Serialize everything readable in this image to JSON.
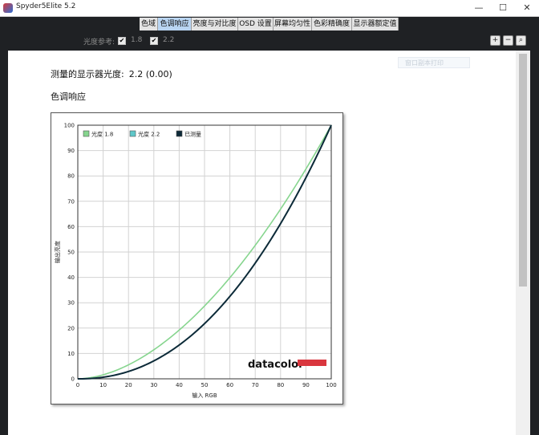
{
  "window": {
    "title": "Spyder5Elite 5.2",
    "minimize": "—",
    "maximize": "☐",
    "close": "✕"
  },
  "tabs": [
    {
      "label": "色域"
    },
    {
      "label": "色调响应",
      "active": true
    },
    {
      "label": "亮度与对比度"
    },
    {
      "label": "OSD 设置"
    },
    {
      "label": "屏幕均匀性"
    },
    {
      "label": "色彩精确度"
    },
    {
      "label": "显示器额定值"
    }
  ],
  "gamma_ref": {
    "label": "光度参考:",
    "opt1": "1.8",
    "opt2": "2.2",
    "check": "✔"
  },
  "zoom": {
    "zoom_in": "+",
    "zoom_out": "−",
    "zoom_fit": "⌕"
  },
  "main": {
    "measure_label": "测量的显示器光度:",
    "measure_value": "2.2 (0.00)",
    "section_title": "色调响应",
    "ghost_button": "窗口副本打印"
  },
  "brand": "datacolor",
  "colors": {
    "gamma18": "#86d58e",
    "gamma22": "#5fc7c9",
    "measured": "#0d2a38",
    "brand_bar": "#d9363e"
  },
  "chart_data": {
    "type": "line",
    "xlabel": "输入 RGB",
    "ylabel": "输出亮度",
    "xlim": [
      0,
      100
    ],
    "ylim": [
      0,
      100
    ],
    "x_ticks": [
      0,
      10,
      20,
      30,
      40,
      50,
      60,
      70,
      80,
      90,
      100
    ],
    "y_ticks": [
      0,
      10,
      20,
      30,
      40,
      50,
      60,
      70,
      80,
      90,
      100
    ],
    "grid": true,
    "legend_position": "top-left",
    "series": [
      {
        "name": "光度 1.8",
        "gamma": 1.8,
        "color": "#86d58e"
      },
      {
        "name": "光度 2.2",
        "gamma": 2.2,
        "color": "#5fc7c9"
      },
      {
        "name": "已测量",
        "gamma": 2.2,
        "color": "#0d2a38"
      }
    ]
  }
}
